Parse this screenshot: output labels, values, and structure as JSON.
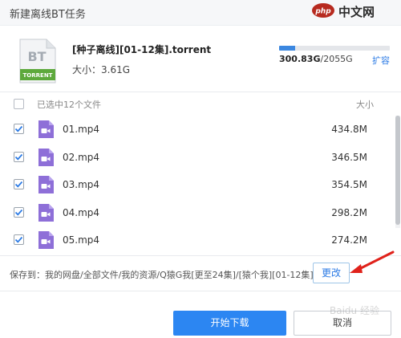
{
  "window": {
    "title": "新建离线BT任务"
  },
  "watermark": {
    "logo_text": "php",
    "site_text": "中文网",
    "bottom_text": "Baidu 经验"
  },
  "torrent": {
    "icon_text": "BT",
    "icon_banner": "TORRENT",
    "name": "[种子离线][01-12集].torrent",
    "size_label": "大小：3.61G"
  },
  "storage": {
    "used": "300.83G",
    "total": "/2055G",
    "used_fraction": 0.146,
    "expand_label": "扩容",
    "bar_color": "#3b87e0"
  },
  "list": {
    "selected_text": "已选中12个文件",
    "size_header": "大小",
    "files": [
      {
        "name": "01.mp4",
        "size": "434.8M"
      },
      {
        "name": "02.mp4",
        "size": "346.5M"
      },
      {
        "name": "03.mp4",
        "size": "354.5M"
      },
      {
        "name": "04.mp4",
        "size": "298.2M"
      },
      {
        "name": "05.mp4",
        "size": "274.2M"
      }
    ],
    "video_icon_color": "#8e6fd8",
    "check_color": "#2c7be5"
  },
  "save": {
    "path_text": "保存到：我的网盘/全部文件/我的资源/Q猿G我[更至24集]/[猿个我][01-12集]",
    "change_label": "更改"
  },
  "footer": {
    "start_label": "开始下载",
    "cancel_label": "取消",
    "primary_color": "#2c86f2"
  }
}
